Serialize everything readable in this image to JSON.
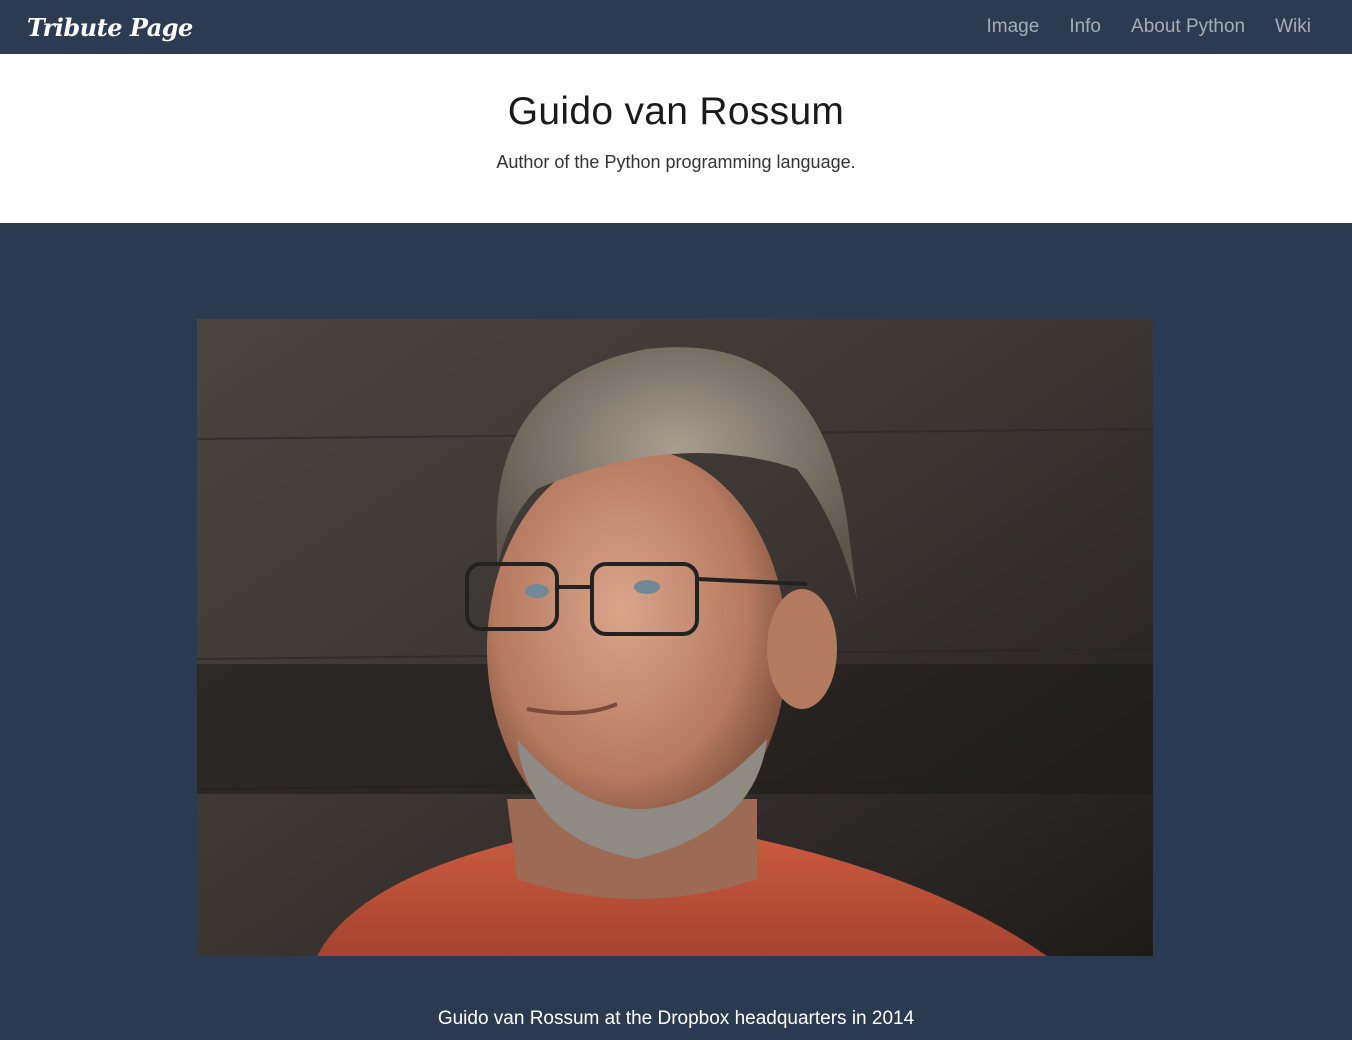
{
  "navbar": {
    "brand": "Tribute Page",
    "links": [
      {
        "label": "Image"
      },
      {
        "label": "Info"
      },
      {
        "label": "About Python"
      },
      {
        "label": "Wiki"
      }
    ]
  },
  "header": {
    "title": "Guido van Rossum",
    "subtitle": "Author of the Python programming language."
  },
  "image_section": {
    "caption": "Guido van Rossum at the Dropbox headquarters in 2014"
  },
  "colors": {
    "navbar_bg": "#2c3a52",
    "section_bg": "#2b3a51",
    "header_bg": "#ffffff",
    "nav_link": "#a6adb8"
  }
}
